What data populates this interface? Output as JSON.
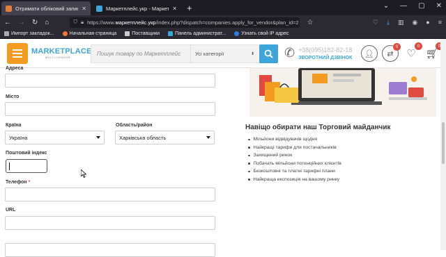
{
  "browser": {
    "tabs": [
      {
        "title": "Отримати обліковий запис по",
        "active": true,
        "favicon_color": "#e57e3a"
      },
      {
        "title": "Маркетплейс.укр - Маркетпле",
        "active": false,
        "favicon_color": "#3da5d9"
      }
    ],
    "url_prefix": "https://www.",
    "url_domain": "маркетплейс.укр",
    "url_rest": "/index.php?dispatch=companies.apply_for_vendor&plan_id=2",
    "bookmarks": [
      {
        "label": "Импорт закладок...",
        "icon": "import-icon"
      },
      {
        "label": "Начальная страница",
        "icon": "firefox-icon"
      },
      {
        "label": "Поставщики",
        "icon": "folder-icon"
      },
      {
        "label": "Панель администрат...",
        "icon": "cscart-icon"
      },
      {
        "label": "Узнать свой IP адрес",
        "icon": "ip-icon"
      }
    ]
  },
  "header": {
    "logo_main": "MARKETPLACE",
    "logo_sub": "MULTI-VENDOR",
    "search_placeholder": "Пошук товару по Маркетплейс",
    "category_select": "Усі категорії",
    "phone": "+38(095)182-82-18",
    "callback": "ЗВОРОТНИЙ ДЗВІНОК",
    "compare_count": "0",
    "wishlist_count": "0",
    "cart_count": "0",
    "accent": "#f39c21",
    "brand_blue": "#3da5d9"
  },
  "form": {
    "address_label": "Адреса",
    "city_label": "Місто",
    "country_label": "Країна",
    "country_value": "Україна",
    "region_label": "Область/район",
    "region_value": "Харківська область",
    "postal_label": "Поштовий індекс",
    "phone_label": "Телефон",
    "required_mark": "*",
    "url_label": "URL"
  },
  "promo": {
    "title": "Навіщо обирати наш Торговий майданчик",
    "items": [
      "Мільйони відвідувачів щодня",
      "Найкращі тарифи для постачальників",
      "Захищений ринок",
      "Побачать мільйони потенційних клієнтів",
      "Безкоштовні та платні тарифні плани",
      "Найкраща експозиція на вашому ринку"
    ]
  }
}
